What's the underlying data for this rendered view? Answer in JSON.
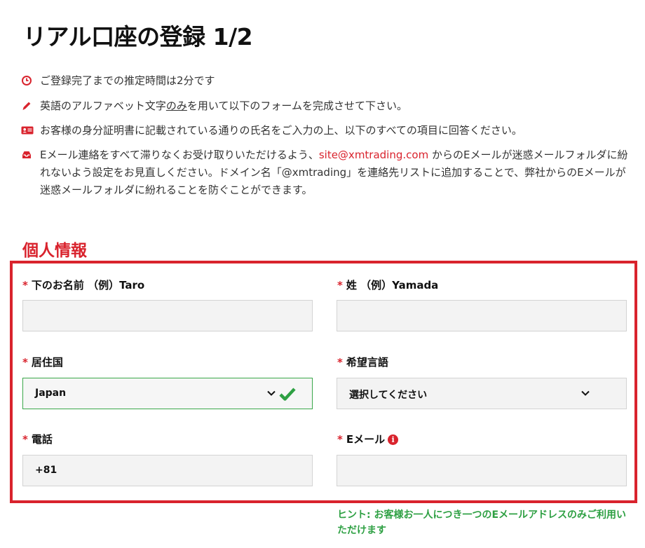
{
  "page": {
    "title": "リアル口座の登録 1/2"
  },
  "info": {
    "time": "ご登録完了までの推定時間は2分です",
    "alphabet_pre": "英語のアルファベット文字",
    "alphabet_em": "のみ",
    "alphabet_post": "を用いて以下のフォームを完成させて下さい。",
    "id_doc": "お客様の身分証明書に記載されている通りの氏名をご入力の上、以下のすべての項目に回答ください。",
    "email_pre": "Eメール連絡をすべて滞りなくお受け取りいただけるよう、",
    "email_link": "site@xmtrading.com",
    "email_post": "からのEメールが迷惑メールフォルダに紛れないよう設定をお見直しください。ドメイン名「@xmtrading」を連絡先リストに追加することで、弊社からのEメールが迷惑メールフォルダに紛れることを防ぐことができます。"
  },
  "section": {
    "title": "個人情報"
  },
  "form": {
    "required_mark": "*",
    "first_name": {
      "label": "下のお名前 （例）Taro",
      "value": ""
    },
    "last_name": {
      "label": "姓 （例）Yamada",
      "value": ""
    },
    "country": {
      "label": "居住国",
      "value": "Japan"
    },
    "language": {
      "label": "希望言語",
      "value": "選択してください"
    },
    "phone": {
      "label": "電話",
      "value": "+81"
    },
    "email": {
      "label": "Eメール",
      "value": ""
    }
  },
  "hint": "ヒント: お客様お一人につき一つのEメールアドレスのみご利用いただけます",
  "colors": {
    "accent_red": "#d9232d",
    "valid_green": "#2ea043"
  },
  "icons": [
    "clock-icon",
    "pencil-icon",
    "id-card-icon",
    "inbox-icon",
    "chevron-down-icon",
    "checkmark-icon",
    "info-icon"
  ]
}
